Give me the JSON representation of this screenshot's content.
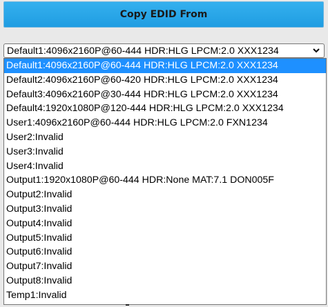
{
  "header": {
    "title": "Copy EDID From"
  },
  "select": {
    "value": "Default1:4096x2160P@60-444 HDR:HLG LPCM:2.0 XXX1234"
  },
  "options": [
    "Default1:4096x2160P@60-444 HDR:HLG LPCM:2.0 XXX1234",
    "Default2:4096x2160P@60-420 HDR:HLG LPCM:2.0 XXX1234",
    "Default3:4096x2160P@30-444 HDR:HLG LPCM:2.0 XXX1234",
    "Default4:1920x1080P@120-444 HDR:HLG LPCM:2.0 XXX1234",
    "User1:4096x2160P@60-444 HDR:HLG LPCM:2.0 FXN1234",
    "User2:Invalid",
    "User3:Invalid",
    "User4:Invalid",
    "Output1:1920x1080P@60-444 HDR:None MAT:7.1 DON005F",
    "Output2:Invalid",
    "Output3:Invalid",
    "Output4:Invalid",
    "Output5:Invalid",
    "Output6:Invalid",
    "Output7:Invalid",
    "Output8:Invalid",
    "Temp1:Invalid"
  ],
  "selected_index": 0,
  "colors": {
    "header_bg": "#29a6e8",
    "selected_bg": "#1e90ff"
  },
  "icons": {
    "dropdown": "chevron-down-icon"
  }
}
